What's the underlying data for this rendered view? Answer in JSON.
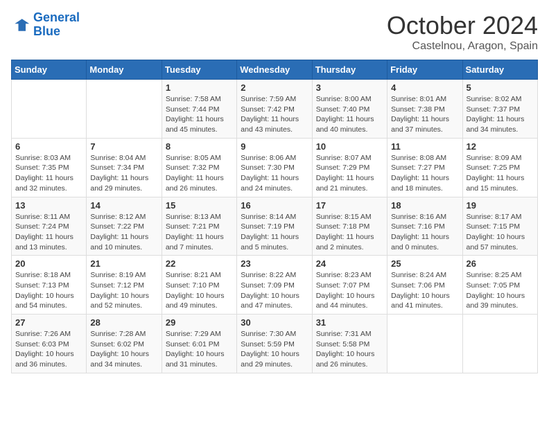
{
  "header": {
    "logo_line1": "General",
    "logo_line2": "Blue",
    "month": "October 2024",
    "location": "Castelnou, Aragon, Spain"
  },
  "days_of_week": [
    "Sunday",
    "Monday",
    "Tuesday",
    "Wednesday",
    "Thursday",
    "Friday",
    "Saturday"
  ],
  "weeks": [
    [
      {
        "day": "",
        "info": ""
      },
      {
        "day": "",
        "info": ""
      },
      {
        "day": "1",
        "info": "Sunrise: 7:58 AM\nSunset: 7:44 PM\nDaylight: 11 hours and 45 minutes."
      },
      {
        "day": "2",
        "info": "Sunrise: 7:59 AM\nSunset: 7:42 PM\nDaylight: 11 hours and 43 minutes."
      },
      {
        "day": "3",
        "info": "Sunrise: 8:00 AM\nSunset: 7:40 PM\nDaylight: 11 hours and 40 minutes."
      },
      {
        "day": "4",
        "info": "Sunrise: 8:01 AM\nSunset: 7:38 PM\nDaylight: 11 hours and 37 minutes."
      },
      {
        "day": "5",
        "info": "Sunrise: 8:02 AM\nSunset: 7:37 PM\nDaylight: 11 hours and 34 minutes."
      }
    ],
    [
      {
        "day": "6",
        "info": "Sunrise: 8:03 AM\nSunset: 7:35 PM\nDaylight: 11 hours and 32 minutes."
      },
      {
        "day": "7",
        "info": "Sunrise: 8:04 AM\nSunset: 7:34 PM\nDaylight: 11 hours and 29 minutes."
      },
      {
        "day": "8",
        "info": "Sunrise: 8:05 AM\nSunset: 7:32 PM\nDaylight: 11 hours and 26 minutes."
      },
      {
        "day": "9",
        "info": "Sunrise: 8:06 AM\nSunset: 7:30 PM\nDaylight: 11 hours and 24 minutes."
      },
      {
        "day": "10",
        "info": "Sunrise: 8:07 AM\nSunset: 7:29 PM\nDaylight: 11 hours and 21 minutes."
      },
      {
        "day": "11",
        "info": "Sunrise: 8:08 AM\nSunset: 7:27 PM\nDaylight: 11 hours and 18 minutes."
      },
      {
        "day": "12",
        "info": "Sunrise: 8:09 AM\nSunset: 7:25 PM\nDaylight: 11 hours and 15 minutes."
      }
    ],
    [
      {
        "day": "13",
        "info": "Sunrise: 8:11 AM\nSunset: 7:24 PM\nDaylight: 11 hours and 13 minutes."
      },
      {
        "day": "14",
        "info": "Sunrise: 8:12 AM\nSunset: 7:22 PM\nDaylight: 11 hours and 10 minutes."
      },
      {
        "day": "15",
        "info": "Sunrise: 8:13 AM\nSunset: 7:21 PM\nDaylight: 11 hours and 7 minutes."
      },
      {
        "day": "16",
        "info": "Sunrise: 8:14 AM\nSunset: 7:19 PM\nDaylight: 11 hours and 5 minutes."
      },
      {
        "day": "17",
        "info": "Sunrise: 8:15 AM\nSunset: 7:18 PM\nDaylight: 11 hours and 2 minutes."
      },
      {
        "day": "18",
        "info": "Sunrise: 8:16 AM\nSunset: 7:16 PM\nDaylight: 11 hours and 0 minutes."
      },
      {
        "day": "19",
        "info": "Sunrise: 8:17 AM\nSunset: 7:15 PM\nDaylight: 10 hours and 57 minutes."
      }
    ],
    [
      {
        "day": "20",
        "info": "Sunrise: 8:18 AM\nSunset: 7:13 PM\nDaylight: 10 hours and 54 minutes."
      },
      {
        "day": "21",
        "info": "Sunrise: 8:19 AM\nSunset: 7:12 PM\nDaylight: 10 hours and 52 minutes."
      },
      {
        "day": "22",
        "info": "Sunrise: 8:21 AM\nSunset: 7:10 PM\nDaylight: 10 hours and 49 minutes."
      },
      {
        "day": "23",
        "info": "Sunrise: 8:22 AM\nSunset: 7:09 PM\nDaylight: 10 hours and 47 minutes."
      },
      {
        "day": "24",
        "info": "Sunrise: 8:23 AM\nSunset: 7:07 PM\nDaylight: 10 hours and 44 minutes."
      },
      {
        "day": "25",
        "info": "Sunrise: 8:24 AM\nSunset: 7:06 PM\nDaylight: 10 hours and 41 minutes."
      },
      {
        "day": "26",
        "info": "Sunrise: 8:25 AM\nSunset: 7:05 PM\nDaylight: 10 hours and 39 minutes."
      }
    ],
    [
      {
        "day": "27",
        "info": "Sunrise: 7:26 AM\nSunset: 6:03 PM\nDaylight: 10 hours and 36 minutes."
      },
      {
        "day": "28",
        "info": "Sunrise: 7:28 AM\nSunset: 6:02 PM\nDaylight: 10 hours and 34 minutes."
      },
      {
        "day": "29",
        "info": "Sunrise: 7:29 AM\nSunset: 6:01 PM\nDaylight: 10 hours and 31 minutes."
      },
      {
        "day": "30",
        "info": "Sunrise: 7:30 AM\nSunset: 5:59 PM\nDaylight: 10 hours and 29 minutes."
      },
      {
        "day": "31",
        "info": "Sunrise: 7:31 AM\nSunset: 5:58 PM\nDaylight: 10 hours and 26 minutes."
      },
      {
        "day": "",
        "info": ""
      },
      {
        "day": "",
        "info": ""
      }
    ]
  ]
}
